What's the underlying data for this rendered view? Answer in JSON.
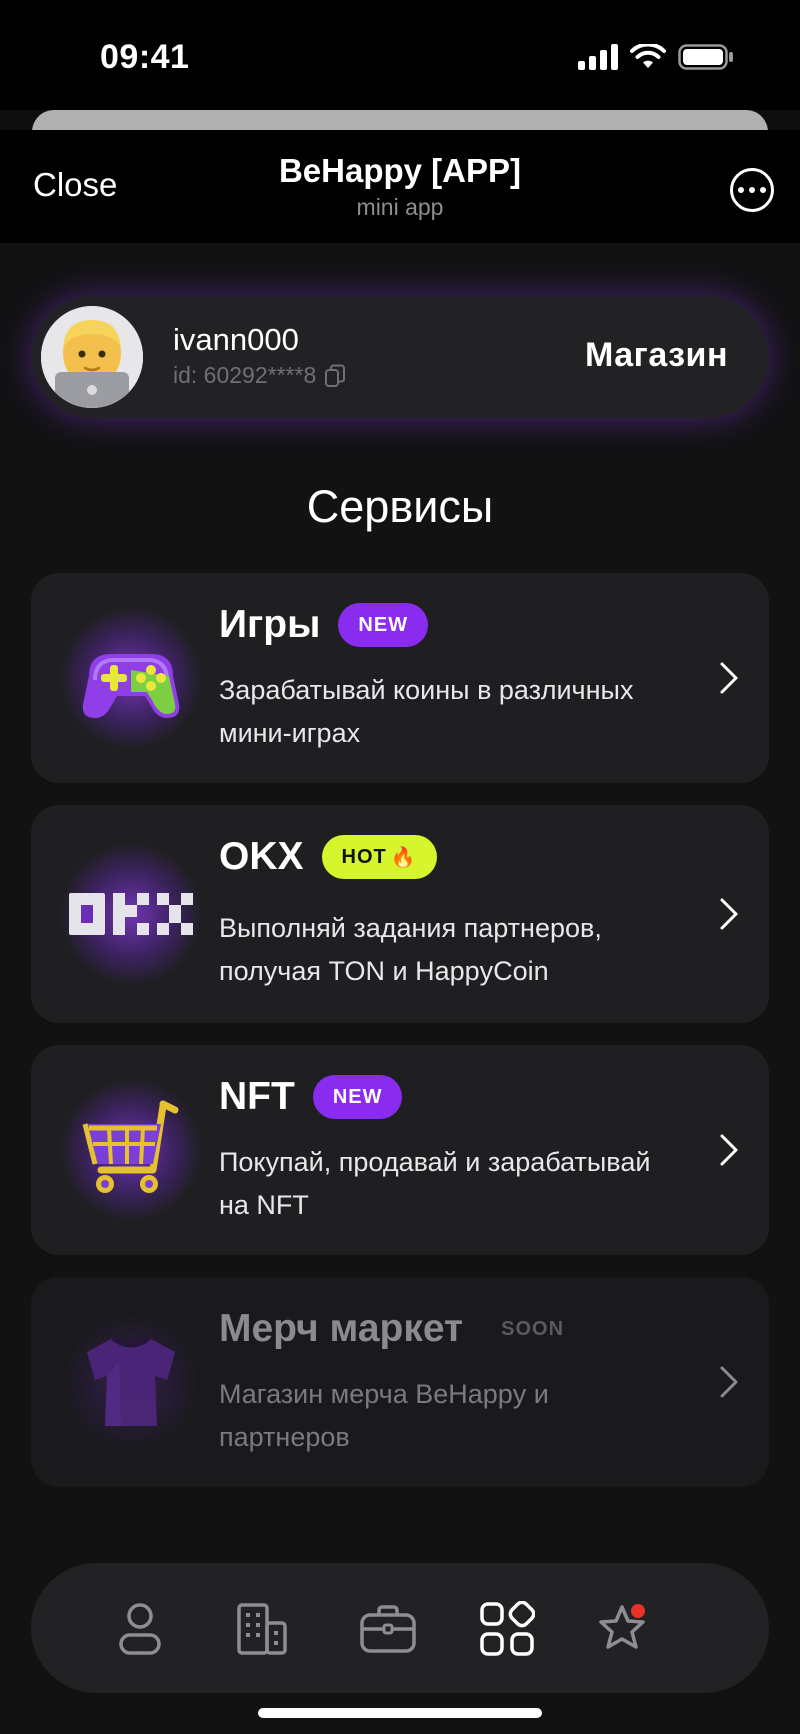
{
  "status_bar": {
    "time": "09:41"
  },
  "header": {
    "close_label": "Close",
    "title": "BeHappy [APP]",
    "subtitle": "mini app"
  },
  "profile": {
    "username": "ivann000",
    "user_id": "id: 60292****8",
    "shop_label": "Магазин"
  },
  "section_title": "Сервисы",
  "services": [
    {
      "title": "Игры",
      "badge": "NEW",
      "description": "Зарабатывай коины в различных мини-играх",
      "icon": "gamepad-icon"
    },
    {
      "title": "OKX",
      "badge": "HOT",
      "badge_emoji": "🔥",
      "description": "Выполняй задания партнеров, получая TON и HappyCoin",
      "icon": "okx-logo"
    },
    {
      "title": "NFT",
      "badge": "NEW",
      "description": "Покупай, продавай и зарабатывай на NFT",
      "icon": "shopping-cart-icon"
    },
    {
      "title": "Мерч маркет",
      "badge": "SOON",
      "description": "Магазин мерча BeHappy и партнеров",
      "icon": "tshirt-icon",
      "disabled": true
    }
  ],
  "bottom_nav": [
    {
      "icon": "profile-icon",
      "active": false
    },
    {
      "icon": "buildings-icon",
      "active": false
    },
    {
      "icon": "briefcase-icon",
      "active": false
    },
    {
      "icon": "apps-grid-icon",
      "active": true
    },
    {
      "icon": "star-icon",
      "active": false,
      "notification_dot": true
    }
  ],
  "colors": {
    "accent_purple": "#8a2cf0",
    "hot_yellow": "#d6f52c",
    "card_bg": "#1f1f22",
    "notification_red": "#e5332a"
  }
}
